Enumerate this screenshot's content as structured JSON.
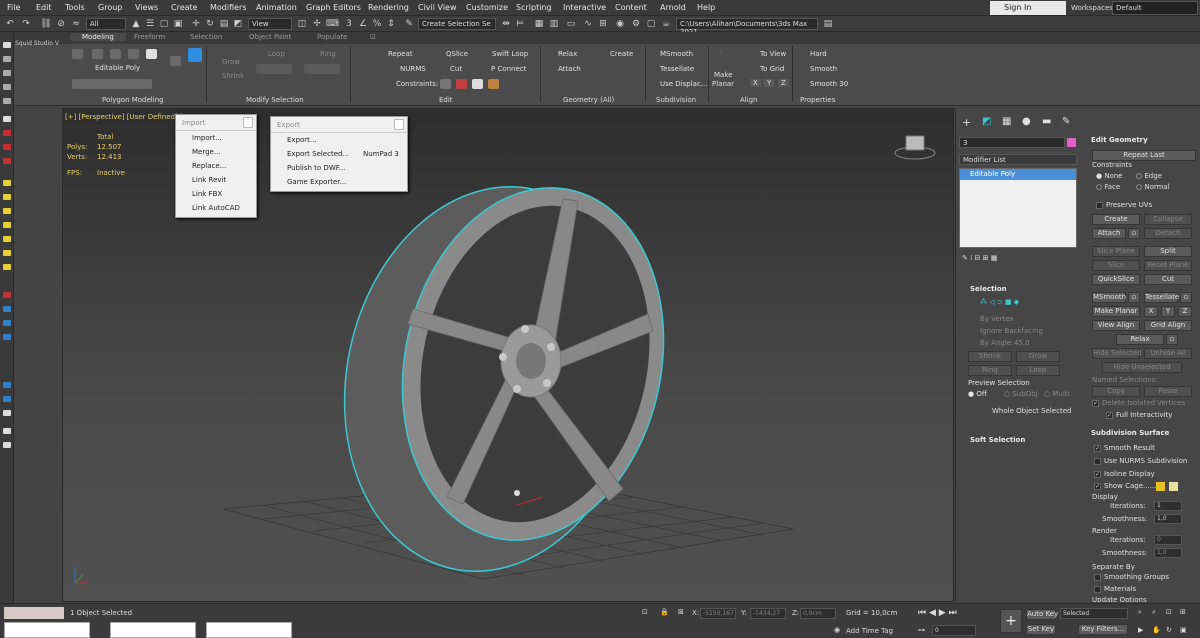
{
  "menu": [
    "File",
    "Edit",
    "Tools",
    "Group",
    "Views",
    "Create",
    "Modifiers",
    "Animation",
    "Graph Editors",
    "Rendering",
    "Civil View",
    "Customize",
    "Scripting",
    "Interactive",
    "Content",
    "Arnold",
    "Help"
  ],
  "signin": "Sign In",
  "workspaces_label": "Workspaces:",
  "workspaces_value": "Default",
  "toolbar": {
    "filter": "All",
    "refcoord": "View",
    "selset": "Create Selection Se",
    "path": "C:\\Users\\Alihan\\Documents\\3ds Max 2021"
  },
  "ribbon_tabs": [
    "Modeling",
    "Freeform",
    "Selection",
    "Object Paint",
    "Populate"
  ],
  "ribbon": {
    "editable_poly": "Editable Poly",
    "grow": "Grow",
    "shrink": "Shrink",
    "loop": "Loop",
    "ring": "Ring",
    "repeat": "Repeat",
    "qslice": "QSlice",
    "swift_loop": "Swift Loop",
    "nurms": "NURMS",
    "cut": "Cut",
    "p_connect": "P Connect",
    "constraints": "Constraints:",
    "relax": "Relax",
    "create": "Create",
    "attach": "Attach",
    "msmooth": "MSmooth",
    "tessellate": "Tessellate",
    "use_displac": "Use Displac...",
    "make": "Make",
    "planar": "Planar",
    "to_view": "To View",
    "to_grid": "To Grid",
    "x": "X",
    "y": "Y",
    "z": "Z",
    "hard": "Hard",
    "smooth": "Smooth",
    "smooth30": "Smooth 30",
    "g_polygon": "Polygon Modeling",
    "g_modify": "Modify Selection",
    "g_edit": "Edit",
    "g_geometry": "Geometry (All)",
    "g_subdivision": "Subdivision",
    "g_align": "Align",
    "g_properties": "Properties"
  },
  "scene_label": "Squid Studio V",
  "viewport": {
    "label": "[+] [Perspective] [User Defined] [",
    "total": "Total",
    "polys_label": "Polys:",
    "polys": "12.507",
    "verts_label": "Verts:",
    "verts": "12.413",
    "fps_label": "FPS:",
    "fps": "Inactive"
  },
  "import_menu": {
    "title": "Import",
    "items": [
      "Import...",
      "Merge...",
      "Replace...",
      "Link Revit",
      "Link FBX",
      "Link AutoCAD"
    ]
  },
  "export_menu": {
    "title": "Export",
    "items": [
      "Export...",
      "Export Selected...",
      "Publish to DWF...",
      "Game Exporter..."
    ],
    "shortcut": "NumPad 3"
  },
  "cmd": {
    "name": "3",
    "modifier_list": "Modifier List",
    "stack_item": "Editable Poly",
    "selection": "Selection",
    "by_vertex": "By Vertex",
    "ignore_backfacing": "Ignore Backfacing",
    "by_angle": "By Angle:",
    "angle": "45,0",
    "shrink": "Shrink",
    "grow": "Grow",
    "ring": "Ring",
    "loop": "Loop",
    "preview": "Preview Selection",
    "off": "Off",
    "subobj": "SubObj",
    "multi": "Multi",
    "whole": "Whole Object Selected",
    "soft": "Soft Selection",
    "edit_geometry": "Edit Geometry",
    "repeat_last": "Repeat Last",
    "constraints": "Constraints",
    "none": "None",
    "edge": "Edge",
    "face": "Face",
    "normal": "Normal",
    "preserve_uvs": "Preserve UVs",
    "create": "Create",
    "collapse": "Collapse",
    "attach": "Attach",
    "detach": "Detach",
    "slice_plane": "Slice Plane",
    "split": "Split",
    "slice": "Slice",
    "reset_plane": "Reset Plane",
    "quickslice": "QuickSlice",
    "cut": "Cut",
    "msmooth": "MSmooth",
    "tessellate": "Tessellate",
    "make_planar": "Make Planar",
    "x": "X",
    "y": "Y",
    "z": "Z",
    "view_align": "View Align",
    "grid_align": "Grid Align",
    "relax": "Relax",
    "hide_selected": "Hide Selected",
    "unhide_all": "Unhide All",
    "hide_unselected": "Hide Unselected",
    "named_selections": "Named Selections:",
    "copy": "Copy",
    "paste": "Paste",
    "delete_isolated": "Delete Isolated Vertices",
    "full_interactivity": "Full Interactivity",
    "subdivision_surface": "Subdivision Surface",
    "smooth_result": "Smooth Result",
    "use_nurms": "Use NURMS Subdivision",
    "isoline": "Isoline Display",
    "show_cage": "Show Cage......",
    "display": "Display",
    "iterations": "Iterations:",
    "smoothness": "Smoothness:",
    "render": "Render",
    "disp_iter": "1",
    "disp_smooth": "1,0",
    "rend_iter": "0",
    "rend_smooth": "1,0",
    "separate_by": "Separate By",
    "smoothing_groups": "Smoothing Groups",
    "materials": "Materials",
    "update_options": "Update Options"
  },
  "status": {
    "selected": "1 Object Selected",
    "x_label": "X:",
    "x": "-5150,167",
    "y_label": "Y:",
    "y": "-1434,27",
    "z_label": "Z:",
    "z": "0,0cm",
    "grid": "Grid = 10,0cm",
    "add_time_tag": "Add Time Tag",
    "frame": "0",
    "auto_key": "Auto Key",
    "set_key": "Set Key",
    "selected_drop": "Selected",
    "key_filters": "Key Filters..."
  },
  "colors": {
    "accent": "#1e90ff",
    "cage1": "#e8c020",
    "cage2": "#e8e0a0",
    "obj_color": "#e060c8",
    "highlight": "#3cc8d0"
  }
}
